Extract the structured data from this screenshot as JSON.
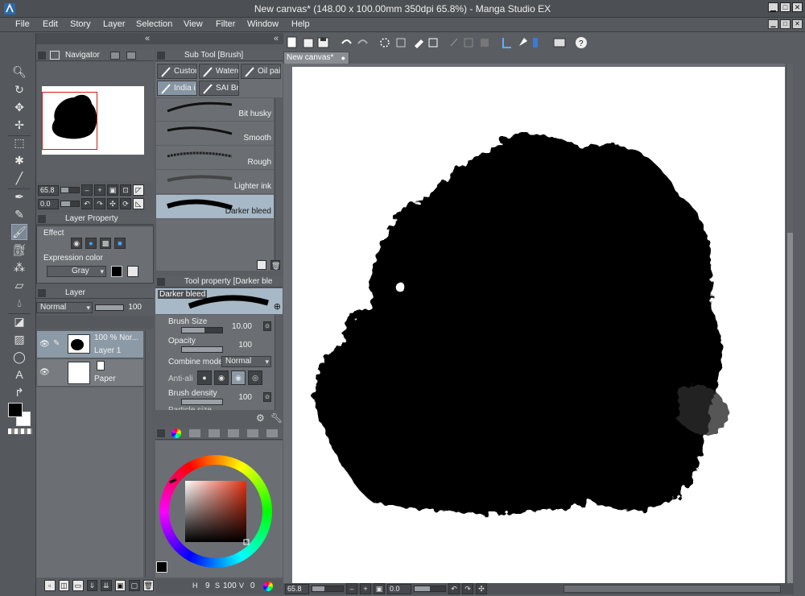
{
  "window": {
    "title": "New canvas* (148.00 x 100.00mm 350dpi 65.8%) - Manga Studio EX",
    "min": "▁",
    "max": "□",
    "close": "✕"
  },
  "menu": [
    "File",
    "Edit",
    "Story",
    "Layer",
    "Selection",
    "View",
    "Filter",
    "Window",
    "Help"
  ],
  "navigator": {
    "tab": "Navigator",
    "zoom": "65.8",
    "angle": "0.0"
  },
  "layer_property": {
    "tab": "Layer Property",
    "effect_label": "Effect",
    "expression_label": "Expression color",
    "expression_value": "Gray"
  },
  "layer_panel": {
    "tab": "Layer",
    "blend_mode": "Normal",
    "opacity": "100",
    "layers": [
      {
        "name": "Layer 1",
        "info": "100 % Nor..."
      },
      {
        "name": "Paper",
        "info": ""
      }
    ]
  },
  "sub_tool": {
    "tab": "Sub Tool [Brush]",
    "groups": [
      "Custom",
      "Waterc",
      "Oil pai",
      "India i",
      "SAI Br"
    ],
    "brushes": [
      "Bit husky",
      "Smooth",
      "Rough",
      "Lighter ink",
      "Darker bleed"
    ],
    "selected": "Darker bleed"
  },
  "tool_property": {
    "tab": "Tool property [Darker ble",
    "preview_label": "Darker bleed",
    "brush_size_label": "Brush Size",
    "brush_size": "10.00",
    "brush_size_fraction": 0.55,
    "opacity_label": "Opacity",
    "opacity": "100",
    "opacity_fraction": 1.0,
    "combine_label": "Combine mode",
    "combine_value": "Normal",
    "antialias_label": "Anti-ali",
    "density_label": "Brush density",
    "density": "100",
    "density_fraction": 1.0,
    "particle_label": "Particle size"
  },
  "color_panel": {
    "h_label": "H",
    "h": "9",
    "s_label": "S",
    "s": "100",
    "v_label": "V",
    "v": "0"
  },
  "document": {
    "tab": "New canvas*",
    "status_zoom": "65.8",
    "status_angle": "0.0"
  },
  "colors": {
    "main": "#000000",
    "sub": "#ffffff",
    "nav_frame": "#d21a1a"
  }
}
